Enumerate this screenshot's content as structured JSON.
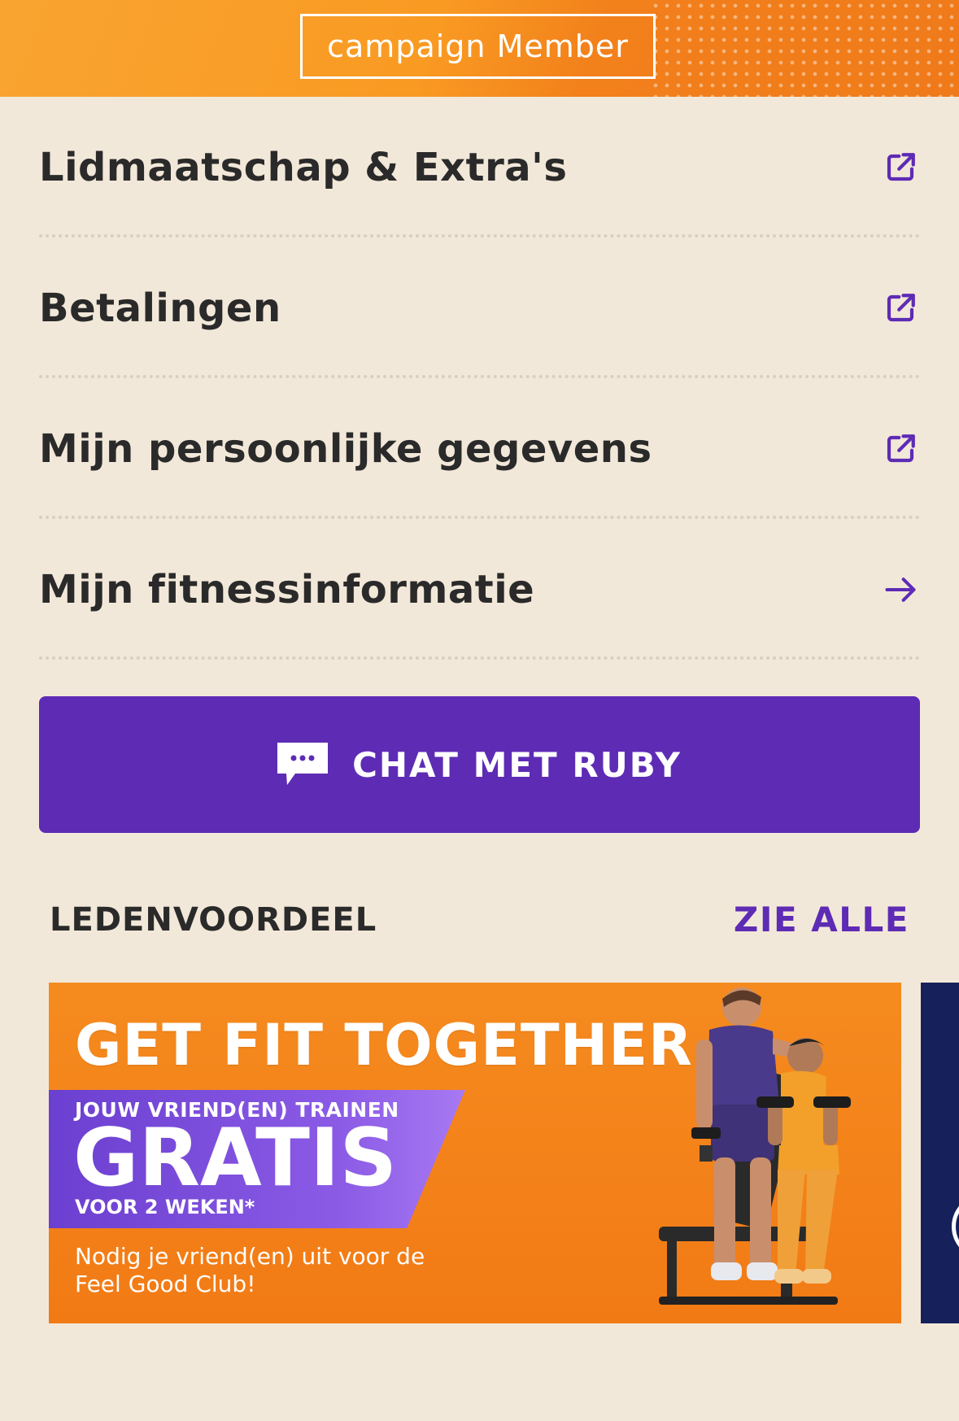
{
  "header": {
    "badge": "campaign Member",
    "accent_color": "#f99a22"
  },
  "menu": {
    "items": [
      {
        "label": "Lidmaatschap & Extra's",
        "icon": "external-link-icon"
      },
      {
        "label": "Betalingen",
        "icon": "external-link-icon"
      },
      {
        "label": "Mijn persoonlijke gegevens",
        "icon": "external-link-icon"
      },
      {
        "label": "Mijn fitnessinformatie",
        "icon": "arrow-right-icon"
      }
    ],
    "icon_color": "#5e2bb5"
  },
  "chat_button": {
    "label": "CHAT MET RUBY",
    "icon": "chat-bubble-icon",
    "color": "#5e2bb5"
  },
  "ledenvoordeel": {
    "title": "LEDENVOORDEEL",
    "see_all": "ZIE ALLE",
    "promo": {
      "headline": "GET FIT TOGETHER",
      "ribbon_top": "JOUW VRIEND(EN) TRAINEN",
      "ribbon_big": "GRATIS",
      "ribbon_bottom": "VOOR 2 WEKEN*",
      "subtext": "Nodig je vriend(en) uit voor de Feel Good Club!"
    }
  }
}
